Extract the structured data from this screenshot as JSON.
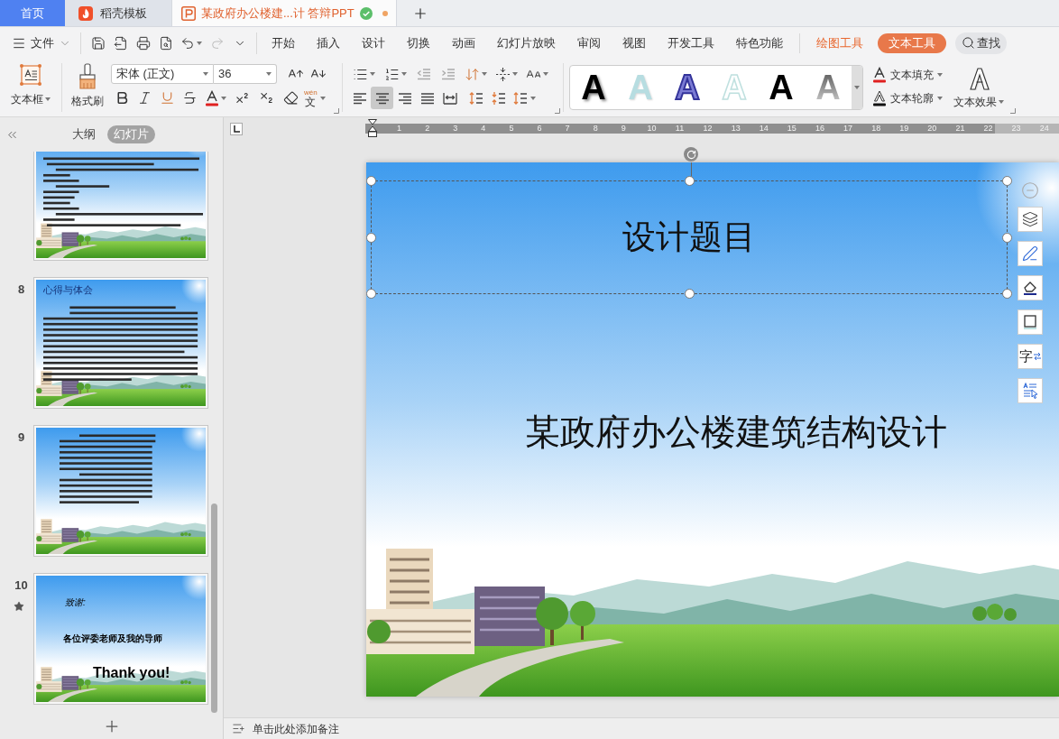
{
  "tabs": [
    {
      "kind": "home",
      "label": "首页",
      "selected": false
    },
    {
      "kind": "template",
      "label": "稻壳模板",
      "selected": false
    },
    {
      "kind": "document",
      "label": "某政府办公楼建...计 答辩PPT",
      "selected": true,
      "synced": true,
      "unsaved": true
    }
  ],
  "file_menu": {
    "label": "文件"
  },
  "menu_tabs": [
    {
      "kind": "main",
      "label": "开始",
      "selected": false
    },
    {
      "kind": "main",
      "label": "插入",
      "selected": false
    },
    {
      "kind": "main",
      "label": "设计",
      "selected": false
    },
    {
      "kind": "main",
      "label": "切换",
      "selected": false
    },
    {
      "kind": "main",
      "label": "动画",
      "selected": false
    },
    {
      "kind": "main",
      "label": "幻灯片放映",
      "selected": false
    },
    {
      "kind": "main",
      "label": "审阅",
      "selected": false
    },
    {
      "kind": "main",
      "label": "视图",
      "selected": false
    },
    {
      "kind": "main",
      "label": "开发工具",
      "selected": false
    },
    {
      "kind": "main",
      "label": "特色功能",
      "selected": false
    },
    {
      "kind": "context",
      "label": "绘图工具",
      "selected": false
    },
    {
      "kind": "context",
      "label": "文本工具",
      "selected": true
    }
  ],
  "search": {
    "label": "查找"
  },
  "ribbon": {
    "text_box": {
      "label": "文本框"
    },
    "format_painter": {
      "label": "格式刷"
    },
    "font": {
      "name": "宋体 (正文)",
      "size": "36"
    },
    "phonetic_guide": {
      "pinyin": "wén",
      "character": "文"
    },
    "alignment": [
      {
        "kind": "left",
        "selected": false
      },
      {
        "kind": "center",
        "selected": true
      },
      {
        "kind": "right",
        "selected": false
      },
      {
        "kind": "justify",
        "selected": false
      },
      {
        "kind": "distributed",
        "selected": false
      }
    ],
    "text_styles": [
      {
        "kind": "shadow",
        "label": "A"
      },
      {
        "kind": "pale",
        "label": "A"
      },
      {
        "kind": "outline-blue",
        "label": "A"
      },
      {
        "kind": "outline-pale",
        "label": "A"
      },
      {
        "kind": "plain",
        "label": "A"
      },
      {
        "kind": "gradient",
        "label": "A"
      }
    ],
    "text_fill": {
      "label": "文本填充"
    },
    "text_outline": {
      "label": "文本轮廓"
    },
    "text_effect": {
      "label": "文本效果"
    }
  },
  "sidebar": {
    "views": [
      {
        "label": "大纲",
        "selected": false
      },
      {
        "label": "幻灯片",
        "selected": true
      }
    ],
    "slides": [
      {
        "kind": "list",
        "animated": false
      },
      {
        "kind": "text",
        "number": "8",
        "title": "心得与体会",
        "animated": false
      },
      {
        "kind": "text",
        "number": "9",
        "animated": false
      },
      {
        "kind": "thanks",
        "number": "10",
        "heading": "致谢:",
        "line": "各位评委老师及我的导师",
        "closing": "Thank you!",
        "animated": true
      }
    ]
  },
  "ruler": {
    "marks": [
      "1",
      "2",
      "3",
      "4",
      "5",
      "6",
      "7",
      "8",
      "9",
      "10",
      "11",
      "12",
      "13",
      "14",
      "15",
      "16",
      "17",
      "18",
      "19",
      "20",
      "21",
      "22",
      "23",
      "24"
    ]
  },
  "slide": {
    "title": "设计题目",
    "title_selected": true,
    "subtitle": "某政府办公楼建筑结构设计"
  },
  "float_tools": [
    {
      "kind": "collapse"
    },
    {
      "kind": "layers"
    },
    {
      "kind": "brush"
    },
    {
      "kind": "fill"
    },
    {
      "kind": "border"
    },
    {
      "kind": "font-replace",
      "glyph": "字"
    },
    {
      "kind": "text-select"
    }
  ],
  "notes": {
    "label": "单击此处添加备注"
  }
}
